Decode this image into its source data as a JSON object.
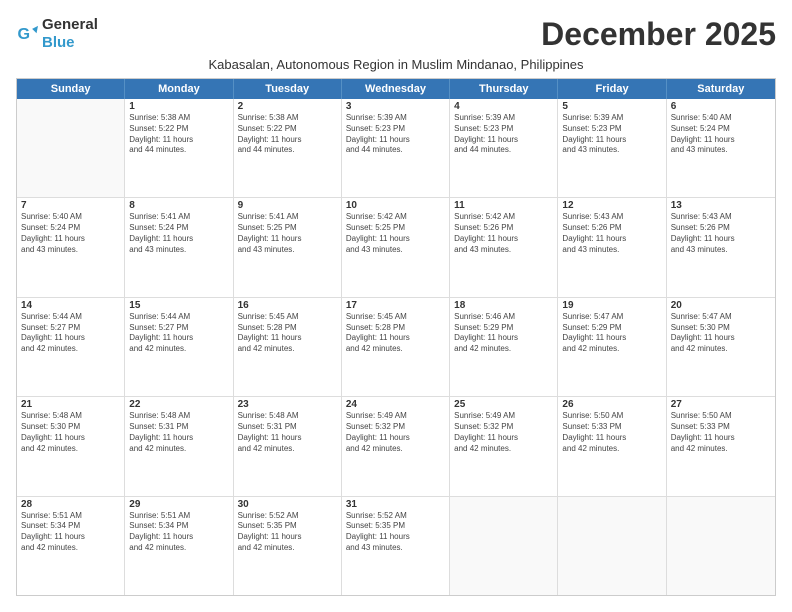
{
  "logo": {
    "general": "General",
    "blue": "Blue"
  },
  "title": "December 2025",
  "subtitle": "Kabasalan, Autonomous Region in Muslim Mindanao, Philippines",
  "days": [
    "Sunday",
    "Monday",
    "Tuesday",
    "Wednesday",
    "Thursday",
    "Friday",
    "Saturday"
  ],
  "weeks": [
    [
      {
        "day": "",
        "info": ""
      },
      {
        "day": "1",
        "info": "Sunrise: 5:38 AM\nSunset: 5:22 PM\nDaylight: 11 hours\nand 44 minutes."
      },
      {
        "day": "2",
        "info": "Sunrise: 5:38 AM\nSunset: 5:22 PM\nDaylight: 11 hours\nand 44 minutes."
      },
      {
        "day": "3",
        "info": "Sunrise: 5:39 AM\nSunset: 5:23 PM\nDaylight: 11 hours\nand 44 minutes."
      },
      {
        "day": "4",
        "info": "Sunrise: 5:39 AM\nSunset: 5:23 PM\nDaylight: 11 hours\nand 44 minutes."
      },
      {
        "day": "5",
        "info": "Sunrise: 5:39 AM\nSunset: 5:23 PM\nDaylight: 11 hours\nand 43 minutes."
      },
      {
        "day": "6",
        "info": "Sunrise: 5:40 AM\nSunset: 5:24 PM\nDaylight: 11 hours\nand 43 minutes."
      }
    ],
    [
      {
        "day": "7",
        "info": "Sunrise: 5:40 AM\nSunset: 5:24 PM\nDaylight: 11 hours\nand 43 minutes."
      },
      {
        "day": "8",
        "info": "Sunrise: 5:41 AM\nSunset: 5:24 PM\nDaylight: 11 hours\nand 43 minutes."
      },
      {
        "day": "9",
        "info": "Sunrise: 5:41 AM\nSunset: 5:25 PM\nDaylight: 11 hours\nand 43 minutes."
      },
      {
        "day": "10",
        "info": "Sunrise: 5:42 AM\nSunset: 5:25 PM\nDaylight: 11 hours\nand 43 minutes."
      },
      {
        "day": "11",
        "info": "Sunrise: 5:42 AM\nSunset: 5:26 PM\nDaylight: 11 hours\nand 43 minutes."
      },
      {
        "day": "12",
        "info": "Sunrise: 5:43 AM\nSunset: 5:26 PM\nDaylight: 11 hours\nand 43 minutes."
      },
      {
        "day": "13",
        "info": "Sunrise: 5:43 AM\nSunset: 5:26 PM\nDaylight: 11 hours\nand 43 minutes."
      }
    ],
    [
      {
        "day": "14",
        "info": "Sunrise: 5:44 AM\nSunset: 5:27 PM\nDaylight: 11 hours\nand 42 minutes."
      },
      {
        "day": "15",
        "info": "Sunrise: 5:44 AM\nSunset: 5:27 PM\nDaylight: 11 hours\nand 42 minutes."
      },
      {
        "day": "16",
        "info": "Sunrise: 5:45 AM\nSunset: 5:28 PM\nDaylight: 11 hours\nand 42 minutes."
      },
      {
        "day": "17",
        "info": "Sunrise: 5:45 AM\nSunset: 5:28 PM\nDaylight: 11 hours\nand 42 minutes."
      },
      {
        "day": "18",
        "info": "Sunrise: 5:46 AM\nSunset: 5:29 PM\nDaylight: 11 hours\nand 42 minutes."
      },
      {
        "day": "19",
        "info": "Sunrise: 5:47 AM\nSunset: 5:29 PM\nDaylight: 11 hours\nand 42 minutes."
      },
      {
        "day": "20",
        "info": "Sunrise: 5:47 AM\nSunset: 5:30 PM\nDaylight: 11 hours\nand 42 minutes."
      }
    ],
    [
      {
        "day": "21",
        "info": "Sunrise: 5:48 AM\nSunset: 5:30 PM\nDaylight: 11 hours\nand 42 minutes."
      },
      {
        "day": "22",
        "info": "Sunrise: 5:48 AM\nSunset: 5:31 PM\nDaylight: 11 hours\nand 42 minutes."
      },
      {
        "day": "23",
        "info": "Sunrise: 5:48 AM\nSunset: 5:31 PM\nDaylight: 11 hours\nand 42 minutes."
      },
      {
        "day": "24",
        "info": "Sunrise: 5:49 AM\nSunset: 5:32 PM\nDaylight: 11 hours\nand 42 minutes."
      },
      {
        "day": "25",
        "info": "Sunrise: 5:49 AM\nSunset: 5:32 PM\nDaylight: 11 hours\nand 42 minutes."
      },
      {
        "day": "26",
        "info": "Sunrise: 5:50 AM\nSunset: 5:33 PM\nDaylight: 11 hours\nand 42 minutes."
      },
      {
        "day": "27",
        "info": "Sunrise: 5:50 AM\nSunset: 5:33 PM\nDaylight: 11 hours\nand 42 minutes."
      }
    ],
    [
      {
        "day": "28",
        "info": "Sunrise: 5:51 AM\nSunset: 5:34 PM\nDaylight: 11 hours\nand 42 minutes."
      },
      {
        "day": "29",
        "info": "Sunrise: 5:51 AM\nSunset: 5:34 PM\nDaylight: 11 hours\nand 42 minutes."
      },
      {
        "day": "30",
        "info": "Sunrise: 5:52 AM\nSunset: 5:35 PM\nDaylight: 11 hours\nand 42 minutes."
      },
      {
        "day": "31",
        "info": "Sunrise: 5:52 AM\nSunset: 5:35 PM\nDaylight: 11 hours\nand 43 minutes."
      },
      {
        "day": "",
        "info": ""
      },
      {
        "day": "",
        "info": ""
      },
      {
        "day": "",
        "info": ""
      }
    ]
  ]
}
